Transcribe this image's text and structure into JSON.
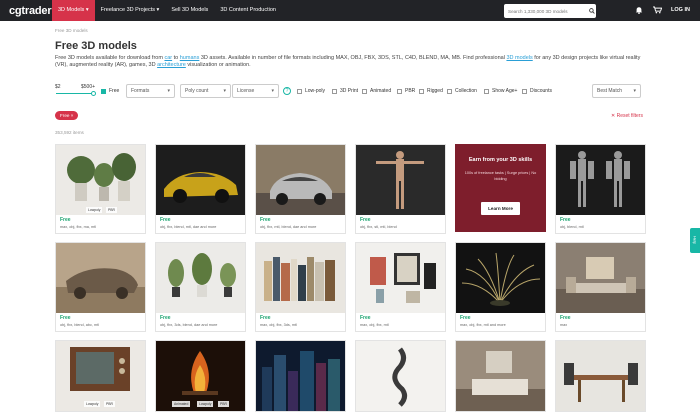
{
  "header": {
    "logo": "cgtrader",
    "nav": [
      {
        "label": "3D Models",
        "active": true
      },
      {
        "label": "Freelance 3D Projects",
        "active": false
      },
      {
        "label": "Sell 3D Models",
        "active": false
      },
      {
        "label": "3D Content Production",
        "active": false
      }
    ],
    "nav_chevron": "▾",
    "search_placeholder": "Search 1,330,000 3D models",
    "icons": [
      "search-icon",
      "bell-icon",
      "cart-icon"
    ],
    "login": "LOG IN",
    "accent": "#d6334a"
  },
  "breadcrumb": "Free 3D models",
  "title": "Free 3D models",
  "description": {
    "p1": "Free 3D models available for download from ",
    "l1": "car",
    "p2": " to ",
    "l2": "humans",
    "p3": " 3D assets. Available in number of file formats including MAX, OBJ, FBX, 3DS, STL, C4D, BLEND, MA, MB. Find professional ",
    "l3": "3D models",
    "p4": " for any 3D design projects like virtual reality (VR), augmented reality (AR), games, 3D ",
    "l4": "architecture",
    "p5": " visualization or animation."
  },
  "filters": {
    "price_min": "$2",
    "price_max": "$500+",
    "free_label": "Free",
    "free_checked": true,
    "formats": "Formats",
    "poly": "Poly count",
    "license": "License",
    "help": "?",
    "lowpoly": "Low-poly",
    "print": "3D Print",
    "animated": "Animated",
    "pbr": "PBR",
    "rigged": "Rigged",
    "collection": "Collection",
    "age": "Show Age+",
    "discounts": "Discounts",
    "sort": "Best Match"
  },
  "active_tag": "Free ×",
  "reset": "✕ Reset filters",
  "result_count": "353,592 items",
  "cards": [
    {
      "price": "Free",
      "formats": "max, obj, fbx, ma, mtl",
      "badges": [
        "Lowpoly",
        "PBR"
      ]
    },
    {
      "price": "Free",
      "formats": "obj, fbx, blend, mtl, dae and more",
      "badges": []
    },
    {
      "price": "Free",
      "formats": "obj, fbx, mtl, blend, dae and more",
      "badges": []
    },
    {
      "price": "Free",
      "formats": "obj, fbx, stl, mtl, blend",
      "badges": []
    },
    {
      "ad": true
    },
    {
      "price": "Free",
      "formats": "obj, blend, mtl",
      "badges": []
    },
    {
      "price": "Free",
      "formats": "obj, fbx, blend, abc, mtl",
      "badges": []
    },
    {
      "price": "Free",
      "formats": "obj, fbx, 3ds, blend, dae and more",
      "badges": []
    },
    {
      "price": "Free",
      "formats": "max, obj, fbx, 3ds, mtl",
      "badges": []
    },
    {
      "price": "Free",
      "formats": "max, obj, fbx, mtl",
      "badges": []
    },
    {
      "price": "Free",
      "formats": "max, obj, fbx, mtl and more",
      "badges": []
    },
    {
      "price": "Free",
      "formats": "max",
      "badges": []
    },
    {
      "badges": [
        "Lowpoly",
        "PBR"
      ]
    },
    {
      "badges": [
        "Animated",
        "Lowpoly",
        "PBR"
      ]
    },
    {
      "badges": []
    },
    {
      "badges": []
    },
    {
      "badges": []
    },
    {
      "badges": []
    }
  ],
  "ad": {
    "heading": "Earn from your 3D skills",
    "sub": "100s of freelance tasks | Surge prices | No bidding",
    "button": "Learn More"
  },
  "help_tab": "Help"
}
